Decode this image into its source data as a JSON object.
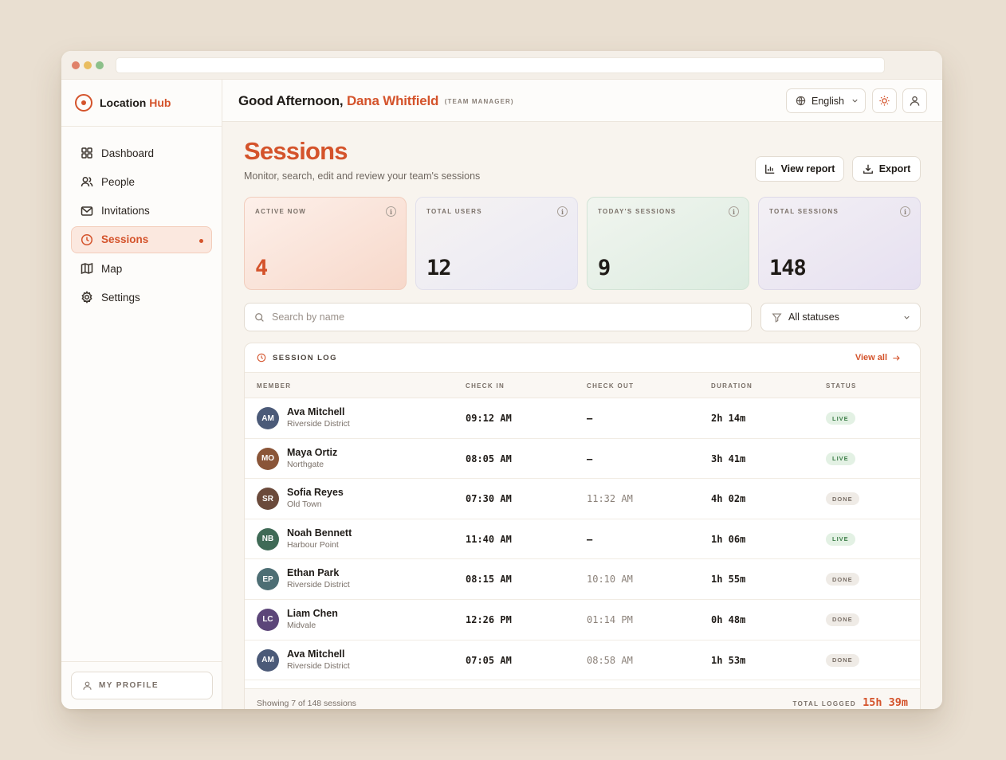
{
  "brand": {
    "name": "Location",
    "accent": "Hub"
  },
  "nav": {
    "items": [
      {
        "label": "Dashboard",
        "icon": "grid-icon"
      },
      {
        "label": "People",
        "icon": "users-icon"
      },
      {
        "label": "Invitations",
        "icon": "mail-icon"
      },
      {
        "label": "Sessions",
        "icon": "clock-icon",
        "active": true
      },
      {
        "label": "Map",
        "icon": "map-icon"
      },
      {
        "label": "Settings",
        "icon": "gear-icon"
      }
    ]
  },
  "profile": {
    "label": "MY PROFILE"
  },
  "header": {
    "greeting": "Good Afternoon,",
    "user_name": "Dana Whitfield",
    "role": "(TEAM MANAGER)",
    "language": "English"
  },
  "page": {
    "title": "Sessions",
    "subtitle": "Monitor, search, edit and review your team's sessions",
    "view_report": "View report",
    "export": "Export"
  },
  "stats": [
    {
      "label": "ACTIVE NOW",
      "value": "4"
    },
    {
      "label": "TOTAL USERS",
      "value": "12"
    },
    {
      "label": "TODAY'S SESSIONS",
      "value": "9"
    },
    {
      "label": "TOTAL SESSIONS",
      "value": "148"
    }
  ],
  "search": {
    "placeholder": "Search by name"
  },
  "filter": {
    "value": "All statuses"
  },
  "log": {
    "title": "SESSION LOG",
    "view_all": "View all",
    "columns": [
      "MEMBER",
      "CHECK IN",
      "CHECK OUT",
      "DURATION",
      "STATUS"
    ],
    "rows": [
      {
        "initials": "AM",
        "color": "#4b5a78",
        "name": "Ava Mitchell",
        "location": "Riverside District",
        "check_in": "09:12 AM",
        "check_out": "—",
        "duration": "2h 14m",
        "status": "LIVE"
      },
      {
        "initials": "MO",
        "color": "#8a5538",
        "name": "Maya Ortiz",
        "location": "Northgate",
        "check_in": "08:05 AM",
        "check_out": "—",
        "duration": "3h 41m",
        "status": "LIVE"
      },
      {
        "initials": "SR",
        "color": "#6b4a3b",
        "name": "Sofia Reyes",
        "location": "Old Town",
        "check_in": "07:30 AM",
        "check_out": "11:32 AM",
        "duration": "4h 02m",
        "status": "DONE"
      },
      {
        "initials": "NB",
        "color": "#3f6a56",
        "name": "Noah Bennett",
        "location": "Harbour Point",
        "check_in": "11:40 AM",
        "check_out": "—",
        "duration": "1h 06m",
        "status": "LIVE"
      },
      {
        "initials": "EP",
        "color": "#4d6e74",
        "name": "Ethan Park",
        "location": "Riverside District",
        "check_in": "08:15 AM",
        "check_out": "10:10 AM",
        "duration": "1h 55m",
        "status": "DONE"
      },
      {
        "initials": "LC",
        "color": "#5c4679",
        "name": "Liam Chen",
        "location": "Midvale",
        "check_in": "12:26 PM",
        "check_out": "01:14 PM",
        "duration": "0h 48m",
        "status": "DONE"
      },
      {
        "initials": "AM",
        "color": "#4b5a78",
        "name": "Ava Mitchell",
        "location": "Riverside District",
        "check_in": "07:05 AM",
        "check_out": "08:58 AM",
        "duration": "1h 53m",
        "status": "DONE"
      }
    ],
    "showing": "Showing 7 of 148 sessions",
    "total_label": "TOTAL LOGGED",
    "total_value": "15h 39m"
  },
  "colors": {
    "accent": "#d4532b",
    "live": "#3f7f4a"
  }
}
